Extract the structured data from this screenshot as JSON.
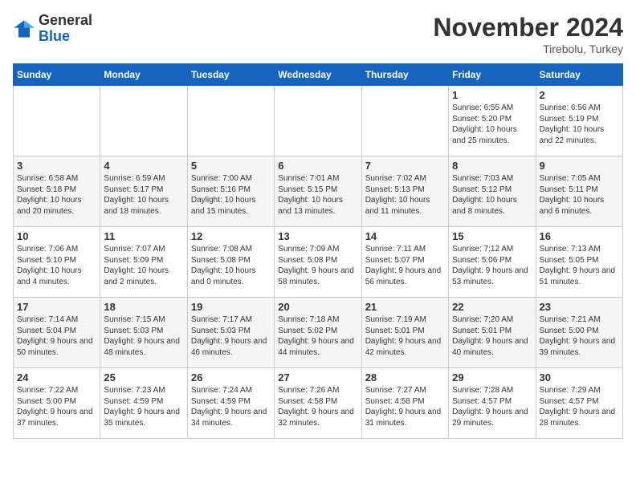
{
  "logo": {
    "general": "General",
    "blue": "Blue"
  },
  "header": {
    "month_year": "November 2024",
    "location": "Tirebolu, Turkey"
  },
  "days_of_week": [
    "Sunday",
    "Monday",
    "Tuesday",
    "Wednesday",
    "Thursday",
    "Friday",
    "Saturday"
  ],
  "weeks": [
    [
      {
        "day": "",
        "info": ""
      },
      {
        "day": "",
        "info": ""
      },
      {
        "day": "",
        "info": ""
      },
      {
        "day": "",
        "info": ""
      },
      {
        "day": "",
        "info": ""
      },
      {
        "day": "1",
        "info": "Sunrise: 6:55 AM\nSunset: 5:20 PM\nDaylight: 10 hours and 25 minutes."
      },
      {
        "day": "2",
        "info": "Sunrise: 6:56 AM\nSunset: 5:19 PM\nDaylight: 10 hours and 22 minutes."
      }
    ],
    [
      {
        "day": "3",
        "info": "Sunrise: 6:58 AM\nSunset: 5:18 PM\nDaylight: 10 hours and 20 minutes."
      },
      {
        "day": "4",
        "info": "Sunrise: 6:59 AM\nSunset: 5:17 PM\nDaylight: 10 hours and 18 minutes."
      },
      {
        "day": "5",
        "info": "Sunrise: 7:00 AM\nSunset: 5:16 PM\nDaylight: 10 hours and 15 minutes."
      },
      {
        "day": "6",
        "info": "Sunrise: 7:01 AM\nSunset: 5:15 PM\nDaylight: 10 hours and 13 minutes."
      },
      {
        "day": "7",
        "info": "Sunrise: 7:02 AM\nSunset: 5:13 PM\nDaylight: 10 hours and 11 minutes."
      },
      {
        "day": "8",
        "info": "Sunrise: 7:03 AM\nSunset: 5:12 PM\nDaylight: 10 hours and 8 minutes."
      },
      {
        "day": "9",
        "info": "Sunrise: 7:05 AM\nSunset: 5:11 PM\nDaylight: 10 hours and 6 minutes."
      }
    ],
    [
      {
        "day": "10",
        "info": "Sunrise: 7:06 AM\nSunset: 5:10 PM\nDaylight: 10 hours and 4 minutes."
      },
      {
        "day": "11",
        "info": "Sunrise: 7:07 AM\nSunset: 5:09 PM\nDaylight: 10 hours and 2 minutes."
      },
      {
        "day": "12",
        "info": "Sunrise: 7:08 AM\nSunset: 5:08 PM\nDaylight: 10 hours and 0 minutes."
      },
      {
        "day": "13",
        "info": "Sunrise: 7:09 AM\nSunset: 5:08 PM\nDaylight: 9 hours and 58 minutes."
      },
      {
        "day": "14",
        "info": "Sunrise: 7:11 AM\nSunset: 5:07 PM\nDaylight: 9 hours and 56 minutes."
      },
      {
        "day": "15",
        "info": "Sunrise: 7:12 AM\nSunset: 5:06 PM\nDaylight: 9 hours and 53 minutes."
      },
      {
        "day": "16",
        "info": "Sunrise: 7:13 AM\nSunset: 5:05 PM\nDaylight: 9 hours and 51 minutes."
      }
    ],
    [
      {
        "day": "17",
        "info": "Sunrise: 7:14 AM\nSunset: 5:04 PM\nDaylight: 9 hours and 50 minutes."
      },
      {
        "day": "18",
        "info": "Sunrise: 7:15 AM\nSunset: 5:03 PM\nDaylight: 9 hours and 48 minutes."
      },
      {
        "day": "19",
        "info": "Sunrise: 7:17 AM\nSunset: 5:03 PM\nDaylight: 9 hours and 46 minutes."
      },
      {
        "day": "20",
        "info": "Sunrise: 7:18 AM\nSunset: 5:02 PM\nDaylight: 9 hours and 44 minutes."
      },
      {
        "day": "21",
        "info": "Sunrise: 7:19 AM\nSunset: 5:01 PM\nDaylight: 9 hours and 42 minutes."
      },
      {
        "day": "22",
        "info": "Sunrise: 7:20 AM\nSunset: 5:01 PM\nDaylight: 9 hours and 40 minutes."
      },
      {
        "day": "23",
        "info": "Sunrise: 7:21 AM\nSunset: 5:00 PM\nDaylight: 9 hours and 39 minutes."
      }
    ],
    [
      {
        "day": "24",
        "info": "Sunrise: 7:22 AM\nSunset: 5:00 PM\nDaylight: 9 hours and 37 minutes."
      },
      {
        "day": "25",
        "info": "Sunrise: 7:23 AM\nSunset: 4:59 PM\nDaylight: 9 hours and 35 minutes."
      },
      {
        "day": "26",
        "info": "Sunrise: 7:24 AM\nSunset: 4:59 PM\nDaylight: 9 hours and 34 minutes."
      },
      {
        "day": "27",
        "info": "Sunrise: 7:26 AM\nSunset: 4:58 PM\nDaylight: 9 hours and 32 minutes."
      },
      {
        "day": "28",
        "info": "Sunrise: 7:27 AM\nSunset: 4:58 PM\nDaylight: 9 hours and 31 minutes."
      },
      {
        "day": "29",
        "info": "Sunrise: 7:28 AM\nSunset: 4:57 PM\nDaylight: 9 hours and 29 minutes."
      },
      {
        "day": "30",
        "info": "Sunrise: 7:29 AM\nSunset: 4:57 PM\nDaylight: 9 hours and 28 minutes."
      }
    ]
  ]
}
